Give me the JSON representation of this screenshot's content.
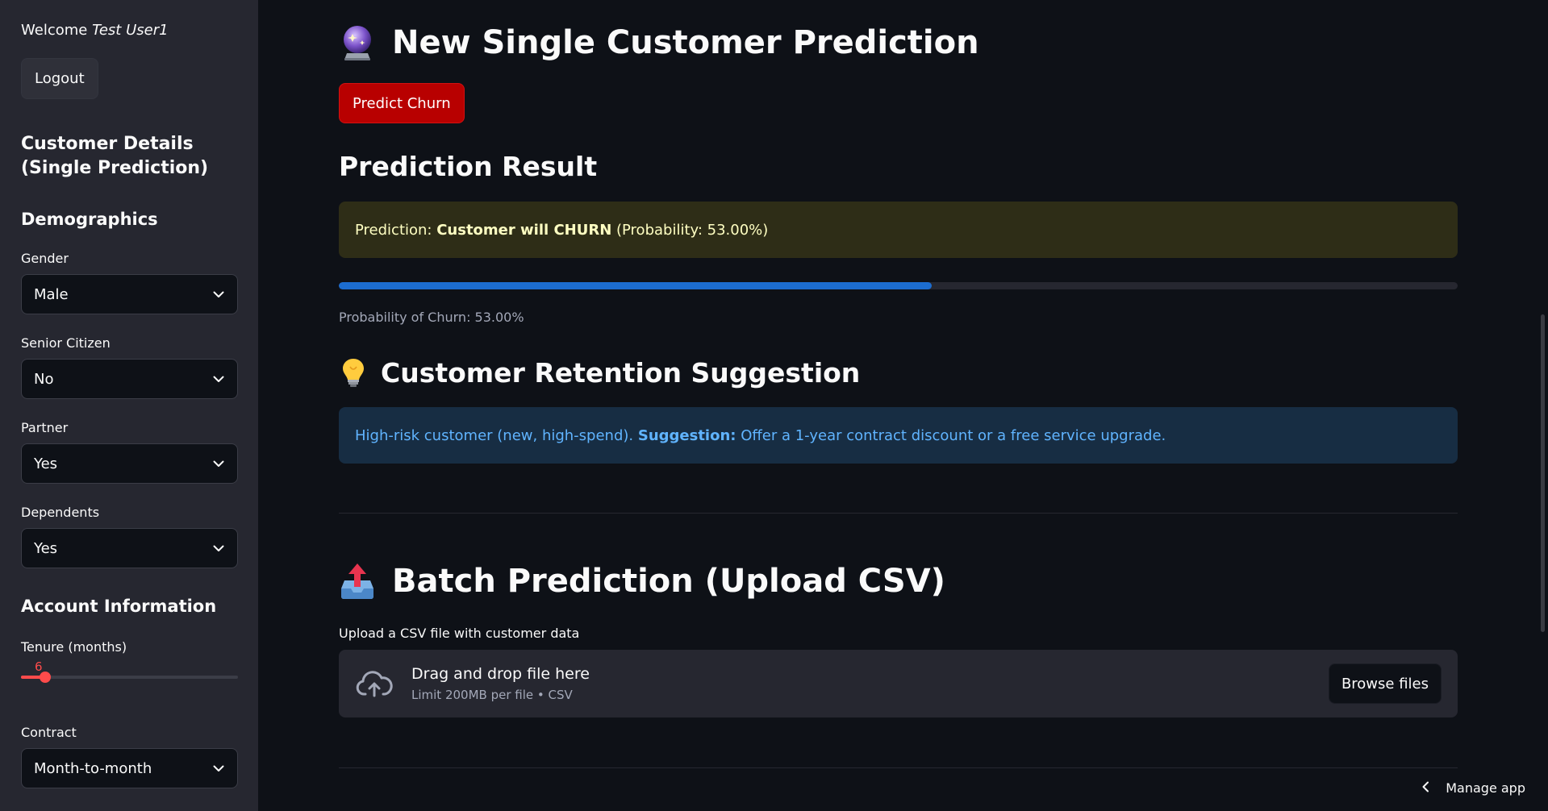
{
  "sidebar": {
    "welcome_prefix": "Welcome ",
    "welcome_user": "Test User1",
    "logout_label": "Logout",
    "title": "Customer Details (Single Prediction)",
    "demographics_heading": "Demographics",
    "gender": {
      "label": "Gender",
      "value": "Male"
    },
    "senior_citizen": {
      "label": "Senior Citizen",
      "value": "No"
    },
    "partner": {
      "label": "Partner",
      "value": "Yes"
    },
    "dependents": {
      "label": "Dependents",
      "value": "Yes"
    },
    "account_heading": "Account Information",
    "tenure": {
      "label": "Tenure (months)",
      "value": "6",
      "min": 0,
      "max": 72
    },
    "contract": {
      "label": "Contract",
      "value": "Month-to-month"
    }
  },
  "main": {
    "single_title": "New Single Customer Prediction",
    "single_icon": "crystal-ball-icon",
    "predict_button": "Predict Churn",
    "result_heading": "Prediction Result",
    "result_alert": {
      "prefix": "Prediction: ",
      "bold": "Customer will CHURN",
      "suffix": " (Probability: 53.00%)"
    },
    "probability": 0.53,
    "probability_caption": "Probability of Churn: 53.00%",
    "retention_heading": "Customer Retention Suggestion",
    "retention_icon": "light-bulb-icon",
    "retention_alert": {
      "prefix": "High-risk customer (new, high-spend). ",
      "bold": "Suggestion:",
      "suffix": " Offer a 1-year contract discount or a free service upgrade."
    },
    "batch_title": "Batch Prediction (Upload CSV)",
    "batch_icon": "outbox-tray-icon",
    "upload_label": "Upload a CSV file with customer data",
    "dropzone_main": "Drag and drop file here",
    "dropzone_sub": "Limit 200MB per file • CSV",
    "browse_button": "Browse files"
  },
  "footer": {
    "manage_app": "Manage app"
  },
  "colors": {
    "background": "#0e1117",
    "sidebar": "#262730",
    "primary_button": "#b80000",
    "progress": "#1c6dd0",
    "slider_accent": "#ff4b4b",
    "warning_text": "#ffffc2",
    "info_text": "#60b4ff"
  }
}
